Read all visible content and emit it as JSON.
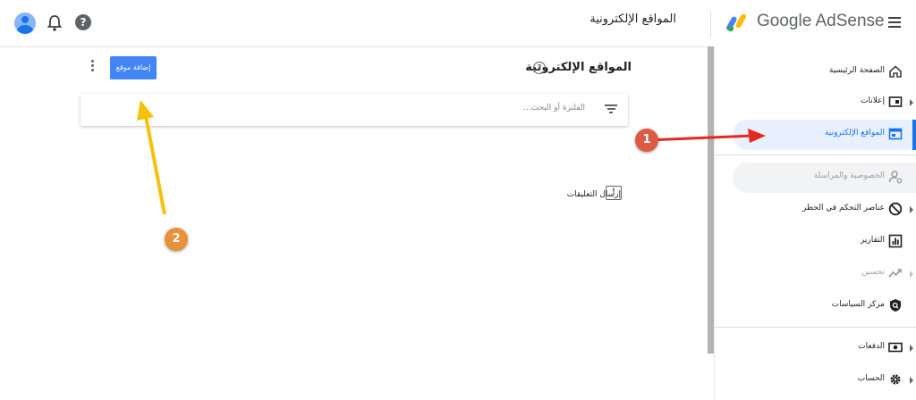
{
  "topbar": {
    "page_title": "المواقع الإلكترونية",
    "brand": "Google AdSense",
    "help_glyph": "?"
  },
  "main": {
    "section_title": "المواقع الإلكترونية",
    "add_site_button": "إضافة موقع",
    "filter_placeholder": "الفلترة أو البحث...",
    "feedback_label": "إرسال التعليقات",
    "feedback_glyph": "!"
  },
  "sidebar": {
    "items": [
      {
        "label": "الصفحة الرئيسية",
        "icon": "home-icon"
      },
      {
        "label": "إعلانات",
        "icon": "ads-icon"
      },
      {
        "label": "المواقع الإلكترونية",
        "icon": "sites-icon"
      },
      {
        "label": "الخصوصية والمراسلة",
        "icon": "privacy-icon"
      },
      {
        "label": "عناصر التحكم في الحظر",
        "icon": "block-icon"
      },
      {
        "label": "التقارير",
        "icon": "reports-icon"
      },
      {
        "label": "تحسين",
        "icon": "optimize-icon"
      },
      {
        "label": "مركز السياسات",
        "icon": "policy-icon"
      },
      {
        "label": "الدفعات",
        "icon": "payments-icon"
      },
      {
        "label": "الحساب",
        "icon": "gear-icon"
      }
    ]
  },
  "annotations": {
    "badge_1": "1",
    "badge_2": "2",
    "arrow_red_color": "#e8281f",
    "arrow_yellow_color": "#f7c10b"
  },
  "colors": {
    "accent": "#1a73e8",
    "button": "#4285f4"
  }
}
